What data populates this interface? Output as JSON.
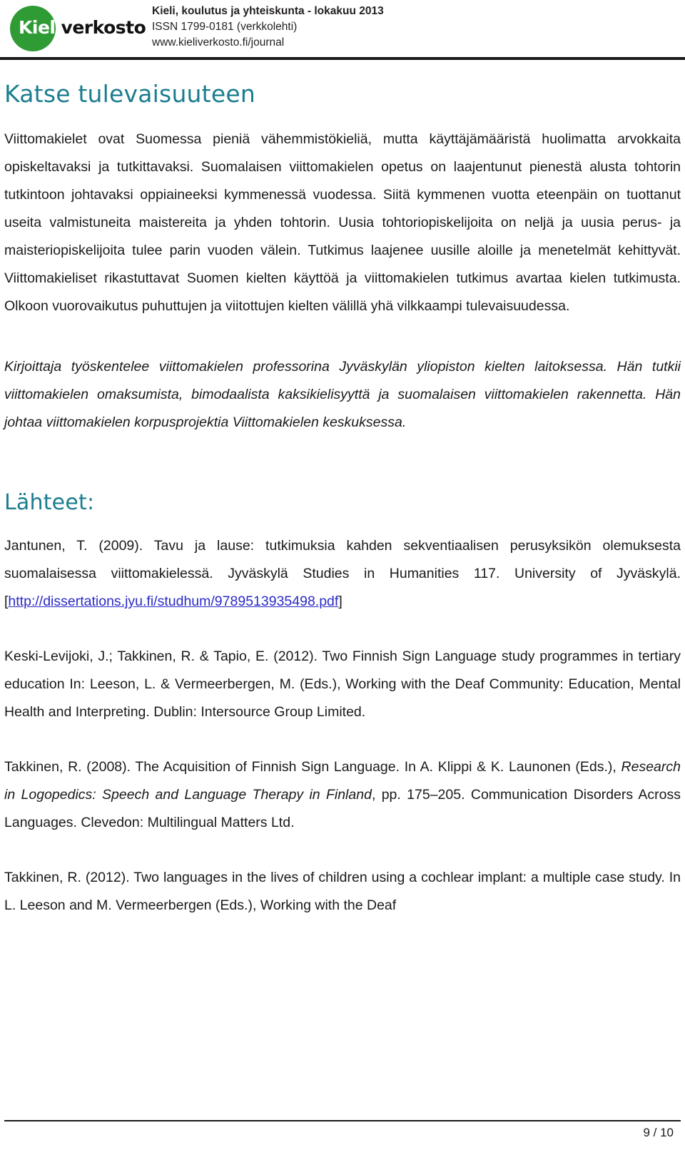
{
  "masthead": {
    "logo": {
      "word_white": "Kieli",
      "word_black": "verkosto",
      "circle_color": "#2f9b35"
    },
    "line1": "Kieli, koulutus ja yhteiskunta - lokakuu 2013",
    "line2": "ISSN 1799-0181 (verkkolehti)",
    "line3": "www.kieliverkosto.fi/journal"
  },
  "article": {
    "title": "Katse tulevaisuuteen",
    "title_color": "#1b7d8f",
    "body_paragraph": "Viittomakielet ovat Suomessa pieniä vähemmistökieliä, mutta käyttäjämääristä huolimatta arvokkaita opiskeltavaksi ja tutkittavaksi. Suomalaisen viittomakielen opetus on laajentunut pienestä alusta tohtorin tutkintoon johtavaksi oppiaineeksi kymmenessä vuodessa. Siitä kymmenen vuotta eteenpäin on tuottanut useita valmistuneita maistereita ja yhden tohtorin. Uusia tohtoriopiskelijoita on neljä ja uusia perus- ja maisteriopiskelijoita tulee parin vuoden välein. Tutkimus laajenee uusille aloille ja menetelmät kehittyvät. Viittomakieliset rikastuttavat Suomen kielten käyttöä ja viittomakielen tutkimus avartaa kielen tutkimusta. Olkoon vuorovaikutus puhuttujen ja viitottujen kielten välillä yhä vilkkaampi tulevaisuudessa.",
    "author_note": "Kirjoittaja työskentelee viittomakielen professorina Jyväskylän yliopiston kielten laitoksessa. Hän tutkii viittomakielen omaksumista, bimodaalista kaksikielisyyttä ja suomalaisen viittomakielen rakennetta. Hän johtaa viittomakielen korpusprojektia Viittomakielen keskuksessa."
  },
  "references": {
    "heading": "Lähteet:",
    "items": [
      {
        "id": "ref-jantunen-2009",
        "before_link": "Jantunen, T. (2009). Tavu ja lause: tutkimuksia kahden sekventiaalisen perusyksikön olemuksesta suomalaisessa viittomakielessä. Jyväskylä Studies in Humanities 117. University of Jyväskylä. [",
        "link_text": "http://dissertations.jyu.fi/studhum/9789513935498.pdf",
        "after_link": "]"
      },
      {
        "id": "ref-keski-levijoki-2012",
        "text": "Keski-Levijoki, J.; Takkinen, R. & Tapio, E. (2012). Two Finnish Sign Language study programmes in tertiary education In: Leeson, L. & Vermeerbergen, M. (Eds.), Working with the Deaf Community: Education, Mental Health and Interpreting. Dublin: Intersource Group Limited."
      },
      {
        "id": "ref-takkinen-2008",
        "part1": "Takkinen, R. (2008). The Acquisition of Finnish Sign Language. In A. Klippi & K. Launonen (Eds.), ",
        "italic": "Research in Logopedics: Speech and Language Therapy in Finland",
        "part2": ", pp. 175–205. Communication Disorders Across Languages. Clevedon: Multilingual Matters Ltd."
      },
      {
        "id": "ref-takkinen-2012",
        "text": "Takkinen, R. (2012). Two languages in the lives of children using a cochlear implant: a multiple case study. In L. Leeson and M. Vermeerbergen (Eds.), Working with the Deaf"
      }
    ]
  },
  "footer": {
    "page_number": "9 / 10"
  },
  "colors": {
    "accent_teal": "#1b7d8f",
    "logo_green": "#2f9b35",
    "link_blue": "#2b2bc8",
    "text": "#1a1a1a"
  }
}
